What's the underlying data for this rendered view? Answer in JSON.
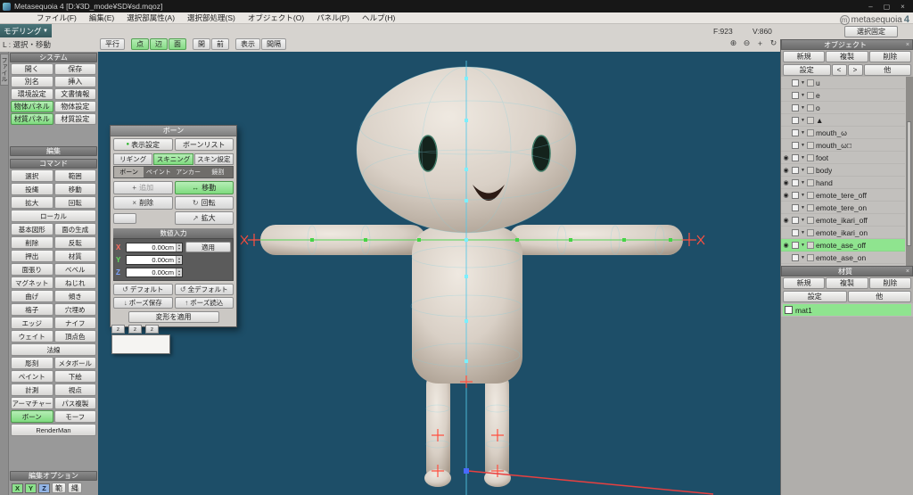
{
  "window": {
    "title": "Metasequoia 4 [D:¥3D_mode¥SD¥sd.mqoz]",
    "controls": {
      "minimize": "–",
      "maximize": "▢",
      "close": "×"
    }
  },
  "icons": {
    "close": "×",
    "caret": "▼",
    "green_dot": "●"
  },
  "menubar": {
    "items": [
      "ファイル(F)",
      "編集(E)",
      "選択部属性(A)",
      "選択部処理(S)",
      "オブジェクト(O)",
      "パネル(P)",
      "ヘルプ(H)"
    ]
  },
  "header": {
    "mode_dropdown": "モデリング",
    "status": "L : 選択・移動",
    "face_count": "F:923",
    "vertex_count": "V:860",
    "lock_button": "選択固定",
    "logo_icon": "m",
    "logo_text": "metasequoia",
    "logo_num": "4",
    "view_toggles": [
      {
        "label": "平行",
        "active": false
      },
      {
        "label": "点",
        "active": true
      },
      {
        "label": "辺",
        "active": true
      },
      {
        "label": "面",
        "active": true
      },
      {
        "label": "開",
        "active": false
      },
      {
        "label": "前",
        "active": false
      },
      {
        "label": "表示",
        "active": false
      },
      {
        "label": "間隔",
        "active": false
      }
    ],
    "viewport_tools": [
      {
        "name": "zoom-in",
        "glyph": "⊕"
      },
      {
        "name": "zoom-out",
        "glyph": "⊖"
      },
      {
        "name": "pan",
        "glyph": "+"
      },
      {
        "name": "rotate-view",
        "glyph": "↻"
      }
    ]
  },
  "sidebar": {
    "file_tab": "ファイル",
    "system": {
      "title": "システム",
      "buttons": [
        {
          "label": "開く"
        },
        {
          "label": "保存"
        },
        {
          "label": "別名"
        },
        {
          "label": "挿入"
        },
        {
          "label": "環境設定"
        },
        {
          "label": "文書情報"
        },
        {
          "label": "物体パネル",
          "active": true
        },
        {
          "label": "物体設定"
        },
        {
          "label": "材質パネル",
          "active": true
        },
        {
          "label": "材質設定"
        }
      ]
    },
    "edit_header": "編集",
    "command": {
      "title": "コマンド",
      "buttons": [
        {
          "label": "選択"
        },
        {
          "label": "範囲"
        },
        {
          "label": "投縄"
        },
        {
          "label": "移動"
        },
        {
          "label": "拡大"
        },
        {
          "label": "回転"
        },
        {
          "label": "ローカル",
          "full": true
        },
        {
          "label": "基本図形"
        },
        {
          "label": "面の生成"
        },
        {
          "label": "削除"
        },
        {
          "label": "反転"
        },
        {
          "label": "押出"
        },
        {
          "label": "材質"
        },
        {
          "label": "面張り"
        },
        {
          "label": "ベベル"
        },
        {
          "label": "マグネット"
        },
        {
          "label": "ねじれ"
        },
        {
          "label": "曲げ"
        },
        {
          "label": "傾き"
        },
        {
          "label": "格子"
        },
        {
          "label": "穴埋め"
        },
        {
          "label": "エッジ"
        },
        {
          "label": "ナイフ"
        },
        {
          "label": "ウェイト"
        },
        {
          "label": "頂点色"
        },
        {
          "label": "法線",
          "full": true
        },
        {
          "label": "彫刻"
        },
        {
          "label": "メタボール"
        },
        {
          "label": "ペイント"
        },
        {
          "label": "下絵"
        },
        {
          "label": "計測"
        },
        {
          "label": "視点"
        },
        {
          "label": "アーマチャー"
        },
        {
          "label": "パス複製"
        },
        {
          "label": "ボーン",
          "active": true
        },
        {
          "label": "モーフ"
        },
        {
          "label": "RenderMan",
          "full": true
        }
      ]
    },
    "edit_options": {
      "title": "編集オプション",
      "axes": [
        {
          "label": "X",
          "checked": true
        },
        {
          "label": "Y",
          "checked": true
        },
        {
          "label": "Z",
          "checked": true
        }
      ],
      "buttons": [
        "範",
        "縄"
      ]
    }
  },
  "bone_panel": {
    "title": "ボーン",
    "display_button": "表示設定",
    "list_button": "ボーンリスト",
    "tabs": [
      {
        "label": "リギング"
      },
      {
        "label": "スキニング",
        "active": true
      },
      {
        "label": "スキン設定"
      }
    ],
    "subtabs": [
      {
        "label": "ボーン",
        "active": true
      },
      {
        "label": "ペイント"
      },
      {
        "label": "アンカー"
      },
      {
        "label": "鏡割"
      }
    ],
    "tools": [
      {
        "label": "追加",
        "icon": "+",
        "disabled": true
      },
      {
        "label": "移動",
        "icon": "↔",
        "active": true
      },
      {
        "label": "削除",
        "icon": "×"
      },
      {
        "label": "回転",
        "icon": "↻"
      },
      {
        "label": "",
        "icon": "",
        "small": true
      },
      {
        "label": "拡大",
        "icon": "↗"
      }
    ],
    "numeric": {
      "title": "数値入力",
      "axes": [
        {
          "label": "X",
          "value": "0.00cm"
        },
        {
          "label": "Y",
          "value": "0.00cm"
        },
        {
          "label": "Z",
          "value": "0.00cm"
        }
      ],
      "apply": "適用"
    },
    "actions": [
      {
        "icon": "↺",
        "icon_name": "reset-icon",
        "label": "デフォルト"
      },
      {
        "icon": "↺",
        "icon_name": "reset-all-icon",
        "label": "全デフォルト"
      },
      {
        "icon": "↓",
        "icon_name": "save-pose-icon",
        "label": "ポーズ保存"
      },
      {
        "icon": "↑",
        "icon_name": "load-pose-icon",
        "label": "ポーズ読込"
      }
    ],
    "apply_transform": "変形を適用"
  },
  "mini_panel": {
    "tabs": [
      "z",
      "z",
      "z"
    ]
  },
  "object_panel": {
    "title": "オブジェクト",
    "buttons": [
      "新規",
      "複製",
      "削除"
    ],
    "row2": [
      {
        "label": "設定",
        "w": "wide"
      },
      {
        "label": "<",
        "w": "narrow"
      },
      {
        "label": ">",
        "w": "narrow"
      },
      {
        "label": "他",
        "w": "wide"
      }
    ],
    "items": [
      {
        "name": "u",
        "visible": false
      },
      {
        "name": "e",
        "visible": false
      },
      {
        "name": "o",
        "visible": false
      },
      {
        "name": "▲",
        "visible": false
      },
      {
        "name": "mouth_ω",
        "visible": false
      },
      {
        "name": "mouth_ω□",
        "visible": false
      },
      {
        "name": "foot",
        "visible": true
      },
      {
        "name": "body",
        "visible": true
      },
      {
        "name": "hand",
        "visible": true
      },
      {
        "name": "emote_tere_off",
        "visible": true
      },
      {
        "name": "emote_tere_on",
        "visible": false
      },
      {
        "name": "emote_ikari_off",
        "visible": true
      },
      {
        "name": "emote_ikari_on",
        "visible": false
      },
      {
        "name": "emote_ase_off",
        "visible": true,
        "selected": true
      },
      {
        "name": "emote_ase_on",
        "visible": false
      }
    ]
  },
  "material_panel": {
    "title": "材質",
    "buttons": [
      "新規",
      "複製",
      "削除"
    ],
    "row2": [
      {
        "label": "設定",
        "w": "wide"
      },
      {
        "label": "他",
        "w": "wide"
      }
    ],
    "items": [
      {
        "name": "mat1",
        "selected": true
      }
    ]
  }
}
